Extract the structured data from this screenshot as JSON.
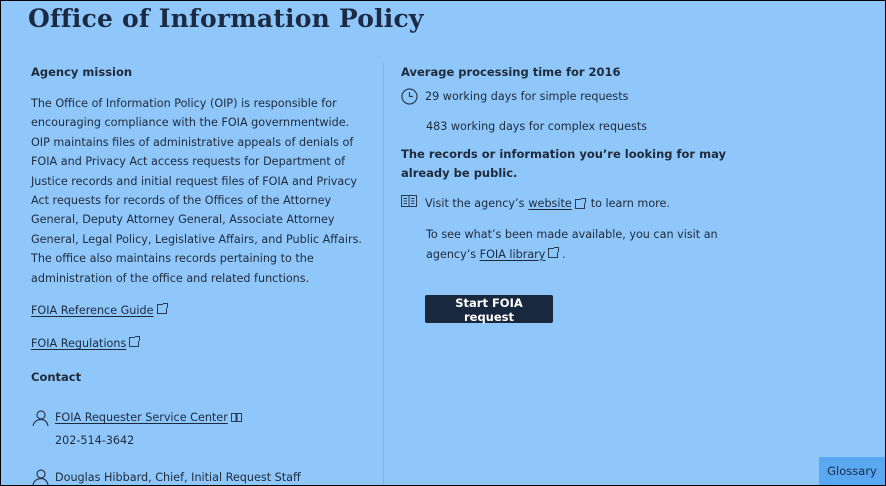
{
  "page": {
    "title": "Office of Information Policy"
  },
  "mission": {
    "heading": "Agency mission",
    "text": "The Office of Information Policy (OIP) is responsible for encouraging compliance with the FOIA governmentwide. OIP maintains files of administrative appeals of denials of FOIA and Privacy Act access requests for Department of Justice records and initial request files of FOIA and Privacy Act requests for records of the Offices of the Attorney General, Deputy Attorney General, Associate Attorney General, Legal Policy, Legislative Affairs, and Public Affairs. The office also maintains records pertaining to the administration of the office and related functions.",
    "links": [
      "FOIA Reference Guide",
      "FOIA Regulations"
    ]
  },
  "contact": {
    "heading": "Contact",
    "service_center": {
      "name": "FOIA Requester Service Center",
      "phone": "202-514-3642"
    },
    "person": "Douglas Hibbard, Chief, Initial Request Staff"
  },
  "processing": {
    "heading": "Average processing time for 2016",
    "simple": "29 working days for simple requests",
    "complex": "483 working days for complex requests"
  },
  "public_records": {
    "heading": "The records or information you’re looking for may already be public.",
    "visit_prefix": "Visit the agency’s",
    "website_link": "website",
    "visit_suffix": "to learn more.",
    "library_text": "To see what’s been made available, you can visit an agency’s",
    "library_link": "FOIA library",
    "library_suffix": "."
  },
  "actions": {
    "start_request": "Start FOIA request",
    "glossary": "Glossary"
  }
}
